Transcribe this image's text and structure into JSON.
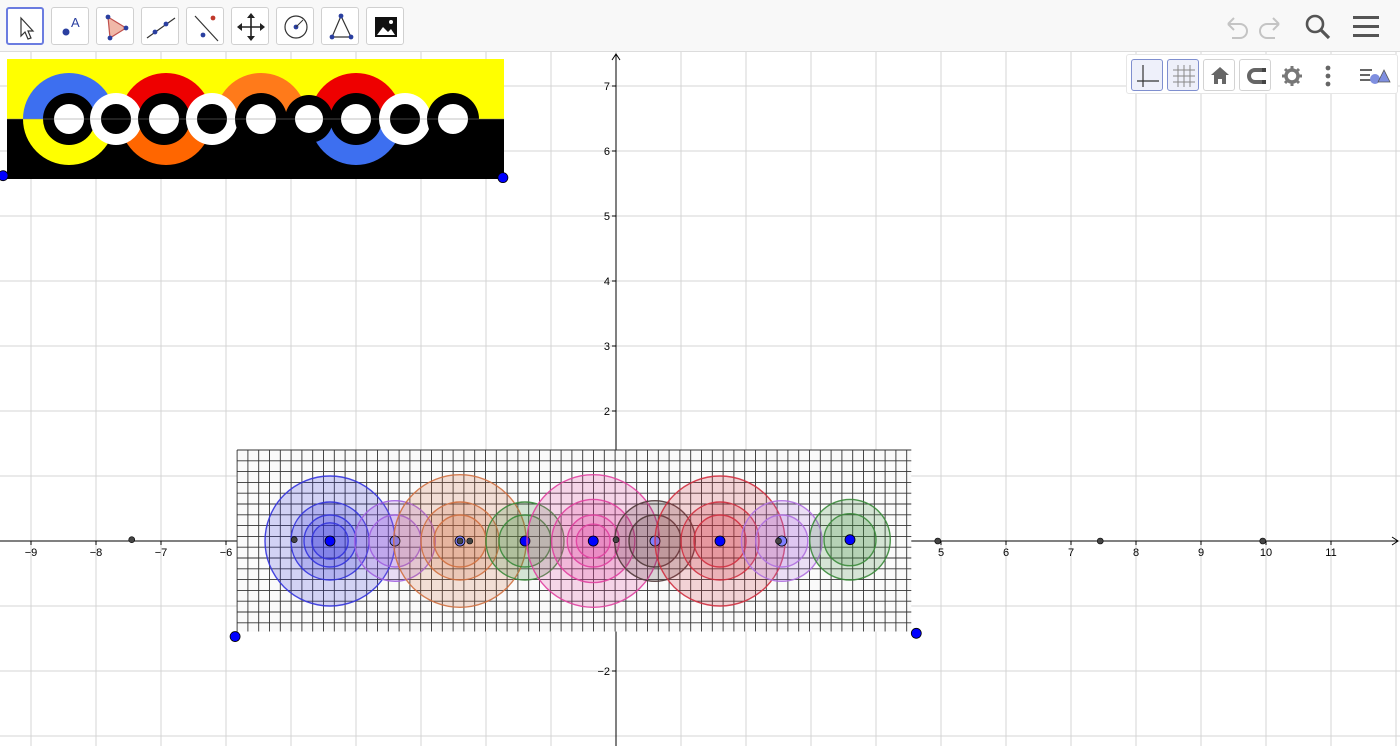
{
  "toolbar": {
    "tools": [
      {
        "name": "move-tool",
        "icon": "arrow-pointer-icon",
        "active": true
      },
      {
        "name": "point-tool",
        "icon": "point-with-label-icon",
        "active": false
      },
      {
        "name": "polygon-tool",
        "icon": "triangle-icon",
        "active": false
      },
      {
        "name": "line-tool",
        "icon": "line-through-points-icon",
        "active": false
      },
      {
        "name": "perpendicular-tool",
        "icon": "perpendicular-line-icon",
        "active": false
      },
      {
        "name": "move-graphics-view-tool",
        "icon": "four-way-arrow-icon",
        "active": false
      },
      {
        "name": "circle-tool",
        "icon": "circle-center-point-icon",
        "active": false
      },
      {
        "name": "angle-tool",
        "icon": "angle-icon",
        "active": false
      },
      {
        "name": "image-tool",
        "icon": "image-icon",
        "active": false
      }
    ],
    "actions": [
      "undo-icon",
      "redo-icon",
      "search-icon",
      "menu-icon"
    ]
  },
  "style_bar": [
    "axes-toggle-icon",
    "grid-toggle-icon",
    "home-icon",
    "magnet-icon",
    "gear-icon",
    "more-vertical-icon",
    "style-bar-toggle-icon"
  ],
  "colors": {
    "axis": "#000000",
    "grid": "#d4d4d4",
    "point": "#0000ff",
    "tick_text": "#000000",
    "active_tool_border": "#6b7ce0"
  },
  "axes": {
    "x_range": [
      -9.5,
      11.9
    ],
    "y_range": [
      -3.1,
      7.5
    ],
    "x_tick_labels": [
      "−9",
      "−8",
      "−7",
      "−6",
      "5",
      "6",
      "7",
      "8",
      "9",
      "10",
      "11"
    ],
    "y_tick_labels": [
      "7",
      "6",
      "5",
      "4",
      "3",
      "2",
      "−2"
    ]
  },
  "points": [
    {
      "x": -7.45,
      "y": 0.02
    },
    {
      "x": -4.95,
      "y": 0.02
    },
    {
      "x": -2.4,
      "y": 0.0
    },
    {
      "x": -2.25,
      "y": 0.0
    },
    {
      "x": 0.0,
      "y": 0.02
    },
    {
      "x": 2.5,
      "y": 0.0
    },
    {
      "x": 4.95,
      "y": 0.0
    },
    {
      "x": 7.45,
      "y": 0.0
    },
    {
      "x": 9.95,
      "y": 0.0
    }
  ],
  "circle_groups": [
    {
      "cx": -4.4,
      "cy": 0.0,
      "color": "#3333dd",
      "radii": [
        1.0,
        0.6,
        0.4,
        0.28
      ]
    },
    {
      "cx": -3.4,
      "cy": 0.0,
      "color": "#a060e0",
      "radii": [
        0.62,
        0.4
      ]
    },
    {
      "cx": -2.4,
      "cy": 0.0,
      "color": "#d07040",
      "radii": [
        1.02,
        0.6,
        0.4
      ]
    },
    {
      "cx": -1.4,
      "cy": 0.0,
      "color": "#3a8a3a",
      "radii": [
        0.6,
        0.4
      ]
    },
    {
      "cx": -0.35,
      "cy": 0.0,
      "color": "#e040a0",
      "radii": [
        1.02,
        0.64,
        0.4,
        0.26
      ]
    },
    {
      "cx": 0.6,
      "cy": 0.0,
      "color": "#503838",
      "radii": [
        0.62,
        0.4
      ]
    },
    {
      "cx": 1.6,
      "cy": 0.0,
      "color": "#d03040",
      "radii": [
        1.0,
        0.6,
        0.4
      ]
    },
    {
      "cx": 2.55,
      "cy": 0.0,
      "color": "#b070e0",
      "radii": [
        0.62,
        0.4
      ]
    },
    {
      "cx": 3.6,
      "cy": 0.02,
      "color": "#3a8a3a",
      "radii": [
        0.62,
        0.4
      ]
    }
  ],
  "images": [
    {
      "name": "banner-image",
      "corners": [
        [
          -9.43,
          5.62
        ],
        [
          -1.74,
          5.59
        ]
      ]
    },
    {
      "name": "grid-image",
      "corners": [
        [
          -5.86,
          -1.47
        ],
        [
          4.62,
          -1.42
        ]
      ]
    }
  ]
}
